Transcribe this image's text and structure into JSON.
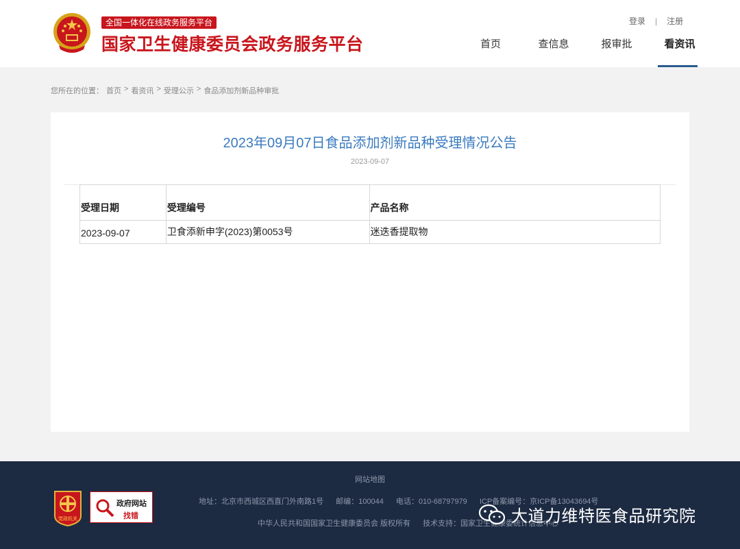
{
  "header": {
    "platform_tag": "全国一体化在线政务服务平台",
    "platform_title": "国家卫生健康委员会政务服务平台",
    "login": "登录",
    "separator": "|",
    "register": "注册",
    "nav": [
      {
        "label": "首页"
      },
      {
        "label": "查信息"
      },
      {
        "label": "报审批"
      },
      {
        "label": "看资讯",
        "active": true
      }
    ]
  },
  "breadcrumb": {
    "prefix": "您所在的位置：",
    "items": [
      "首页",
      "看资讯",
      "受理公示",
      "食品添加剂新品种审批"
    ],
    "sep": ">"
  },
  "article": {
    "title": "2023年09月07日食品添加剂新品种受理情况公告",
    "date": "2023-09-07"
  },
  "table": {
    "headers": [
      "受理日期",
      "受理编号",
      "产品名称"
    ],
    "rows": [
      [
        "2023-09-07",
        "卫食添新申字(2023)第0053号",
        "迷迭香提取物"
      ]
    ]
  },
  "footer": {
    "sitemap": "网站地图",
    "address": "地址：北京市西城区西直门外南路1号",
    "postcode": "邮编：100044",
    "phone": "电话：010-68797979",
    "icp": "ICP备案编号：京ICP备13043694号",
    "copyright": "中华人民共和国国家卫生健康委员会 版权所有",
    "tech_support": "技术支持：国家卫生健康委统计信息中心",
    "badge_text": "党政机关",
    "find_error_top": "政府网站",
    "find_error_bottom": "找错"
  },
  "watermark": {
    "text": "大道力维特医食品研究院",
    "icon": "wechat-icon"
  },
  "colors": {
    "brand_red": "#c8161d",
    "title_blue": "#3b7bbf",
    "nav_underline": "#2a5b8f",
    "footer_bg": "#1c2a42"
  }
}
